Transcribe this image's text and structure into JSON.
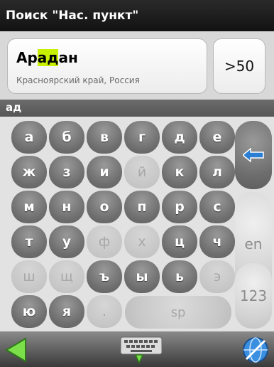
{
  "header": {
    "title": "Поиск \"Нас. пункт\""
  },
  "result": {
    "name_prefix": "Ар",
    "name_match": "ад",
    "name_suffix": "ан",
    "region": "Красноярский край, Россия",
    "count": ">50"
  },
  "query": "ад",
  "keyboard": {
    "rows": [
      [
        {
          "label": "а",
          "enabled": true
        },
        {
          "label": "б",
          "enabled": true
        },
        {
          "label": "в",
          "enabled": true
        },
        {
          "label": "г",
          "enabled": true
        },
        {
          "label": "д",
          "enabled": true
        },
        {
          "label": "е",
          "enabled": true
        }
      ],
      [
        {
          "label": "ж",
          "enabled": true
        },
        {
          "label": "з",
          "enabled": true
        },
        {
          "label": "и",
          "enabled": true
        },
        {
          "label": "й",
          "enabled": false
        },
        {
          "label": "к",
          "enabled": true
        },
        {
          "label": "л",
          "enabled": true
        }
      ],
      [
        {
          "label": "м",
          "enabled": true
        },
        {
          "label": "н",
          "enabled": true
        },
        {
          "label": "о",
          "enabled": true
        },
        {
          "label": "п",
          "enabled": true
        },
        {
          "label": "р",
          "enabled": true
        },
        {
          "label": "с",
          "enabled": true
        }
      ],
      [
        {
          "label": "т",
          "enabled": true
        },
        {
          "label": "у",
          "enabled": true
        },
        {
          "label": "ф",
          "enabled": false
        },
        {
          "label": "х",
          "enabled": false
        },
        {
          "label": "ц",
          "enabled": true
        },
        {
          "label": "ч",
          "enabled": true
        }
      ],
      [
        {
          "label": "ш",
          "enabled": false
        },
        {
          "label": "щ",
          "enabled": false
        },
        {
          "label": "ъ",
          "enabled": true
        },
        {
          "label": "ы",
          "enabled": true
        },
        {
          "label": "ь",
          "enabled": true
        },
        {
          "label": "э",
          "enabled": false
        }
      ],
      [
        {
          "label": "ю",
          "enabled": true
        },
        {
          "label": "я",
          "enabled": true
        },
        {
          "label": ".",
          "enabled": false
        }
      ]
    ],
    "space_label": "sp",
    "lang_label": "en",
    "numeric_label": "123"
  },
  "bottom": {
    "back_icon": "back-triangle-icon",
    "keyboard_icon": "keyboard-icon",
    "globe_icon": "globe-icon"
  },
  "colors": {
    "highlight": "#c6f000",
    "backspace_arrow": "#2a7fd4"
  }
}
